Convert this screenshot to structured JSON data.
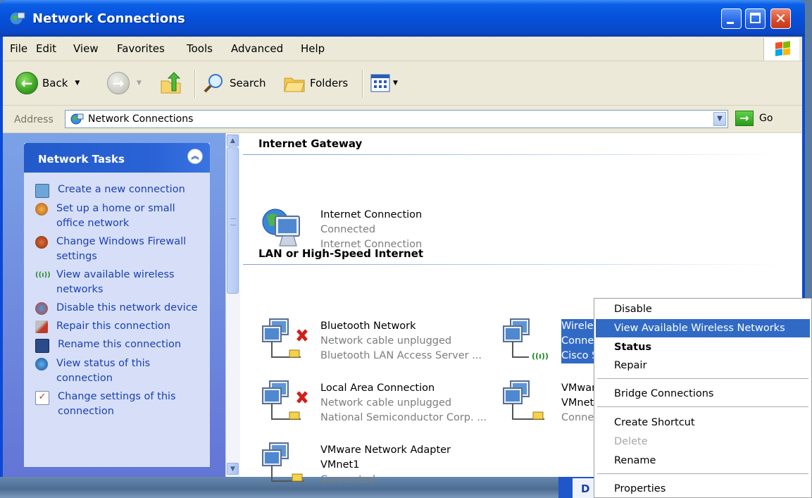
{
  "window": {
    "title": "Network Connections"
  },
  "menubar": {
    "items": [
      "File",
      "Edit",
      "View",
      "Favorites",
      "Tools",
      "Advanced",
      "Help"
    ]
  },
  "toolbar": {
    "back_label": "Back",
    "search_label": "Search",
    "folders_label": "Folders"
  },
  "address": {
    "label": "Address",
    "value": "Network Connections",
    "go_label": "Go"
  },
  "taskpane": {
    "title": "Network Tasks",
    "tasks": [
      {
        "label": "Create a new connection",
        "icon": "new-connection-icon"
      },
      {
        "label": "Set up a home or small office network",
        "icon": "home-network-icon"
      },
      {
        "label": "Change Windows Firewall settings",
        "icon": "firewall-icon"
      },
      {
        "label": "View available wireless networks",
        "icon": "wireless-icon"
      },
      {
        "label": "Disable this network device",
        "icon": "disable-device-icon"
      },
      {
        "label": "Repair this connection",
        "icon": "repair-icon"
      },
      {
        "label": "Rename this connection",
        "icon": "rename-icon"
      },
      {
        "label": "View status of this connection",
        "icon": "status-icon"
      },
      {
        "label": "Change settings of this connection",
        "icon": "settings-icon"
      }
    ]
  },
  "content": {
    "groups": [
      {
        "header": "Internet Gateway"
      },
      {
        "header": "LAN or High-Speed Internet"
      }
    ],
    "gateway": {
      "name": "Internet Connection",
      "status": "Connected",
      "device": "Internet Connection"
    },
    "connections": [
      {
        "name": "Bluetooth Network",
        "status": "Network cable unplugged",
        "device": "Bluetooth LAN Access Server ..."
      },
      {
        "name": "Wireless Network Connection",
        "status": "Conne",
        "device": "Cisco S"
      },
      {
        "name": "Local Area Connection",
        "status": "Network cable unplugged",
        "device": "National Semiconductor Corp. ..."
      },
      {
        "name": "VMwar",
        "status": "VMnet",
        "device": "Conne"
      },
      {
        "name": "VMware Network Adapter",
        "status": "VMnet1",
        "device": "Connected"
      }
    ]
  },
  "context_menu": {
    "items": [
      "Disable",
      "View Available Wireless Networks",
      "Status",
      "Repair",
      "Bridge Connections",
      "Create Shortcut",
      "Delete",
      "Rename",
      "Properties"
    ],
    "highlighted": "View Available Wireless Networks"
  },
  "taskbar_peek": {
    "label": "D"
  },
  "colors": {
    "title_bar": "#0550d9",
    "selection": "#316ac5",
    "link": "#1b3fb5",
    "task_pane_bg": "#6375d6"
  }
}
